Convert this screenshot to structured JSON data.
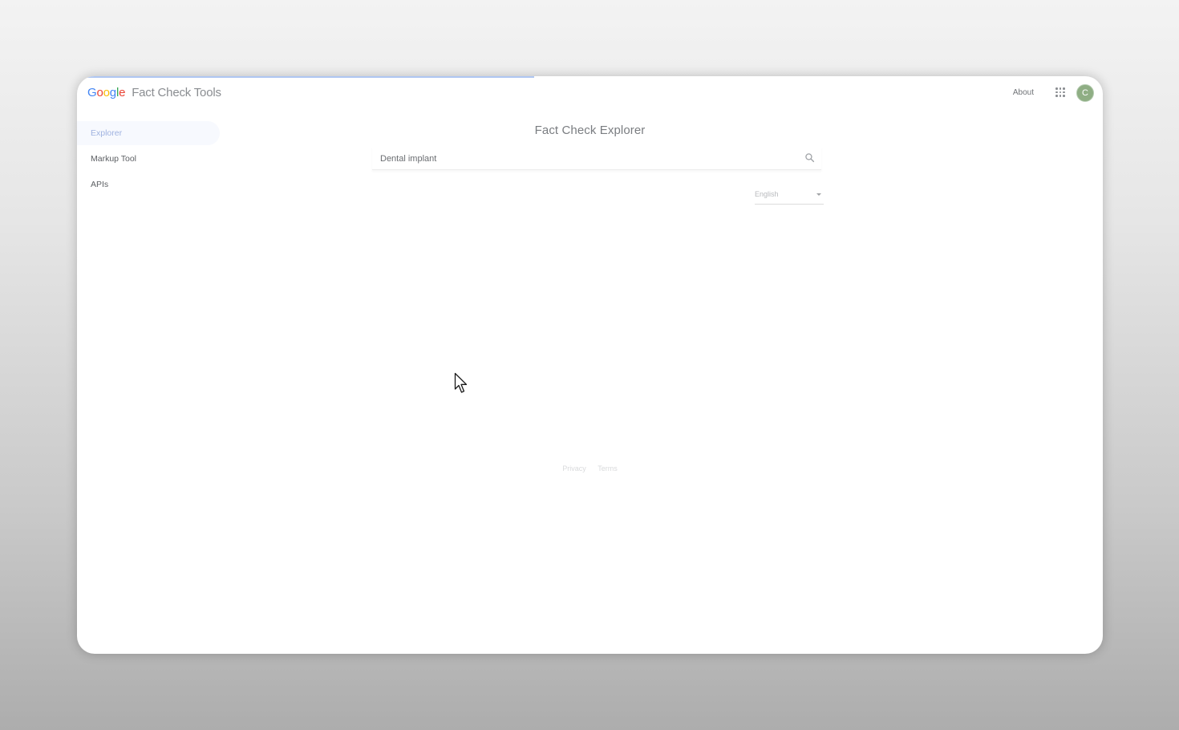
{
  "header": {
    "logo_letters": [
      {
        "char": "G",
        "color": "#4285F4"
      },
      {
        "char": "o",
        "color": "#EA4335"
      },
      {
        "char": "o",
        "color": "#FBBC05"
      },
      {
        "char": "g",
        "color": "#4285F4"
      },
      {
        "char": "l",
        "color": "#34A853"
      },
      {
        "char": "e",
        "color": "#EA4335"
      }
    ],
    "product_name": "Fact Check Tools",
    "about_label": "About",
    "avatar_initial": "C",
    "avatar_color": "#8fae84",
    "progress_fraction": 0.446
  },
  "sidebar": {
    "items": [
      {
        "label": "Explorer",
        "active": true
      },
      {
        "label": "Markup Tool",
        "active": false
      },
      {
        "label": "APIs",
        "active": false
      }
    ]
  },
  "main": {
    "title": "Fact Check Explorer",
    "search": {
      "value": "Dental implant",
      "placeholder": ""
    },
    "language": {
      "selected": "English"
    }
  },
  "footer": {
    "links": [
      "Privacy",
      "Terms"
    ]
  },
  "icons": {
    "search": "search-icon",
    "apps": "apps-grid-icon",
    "dropdown": "chevron-down-icon",
    "cursor": "mouse-cursor-icon"
  }
}
